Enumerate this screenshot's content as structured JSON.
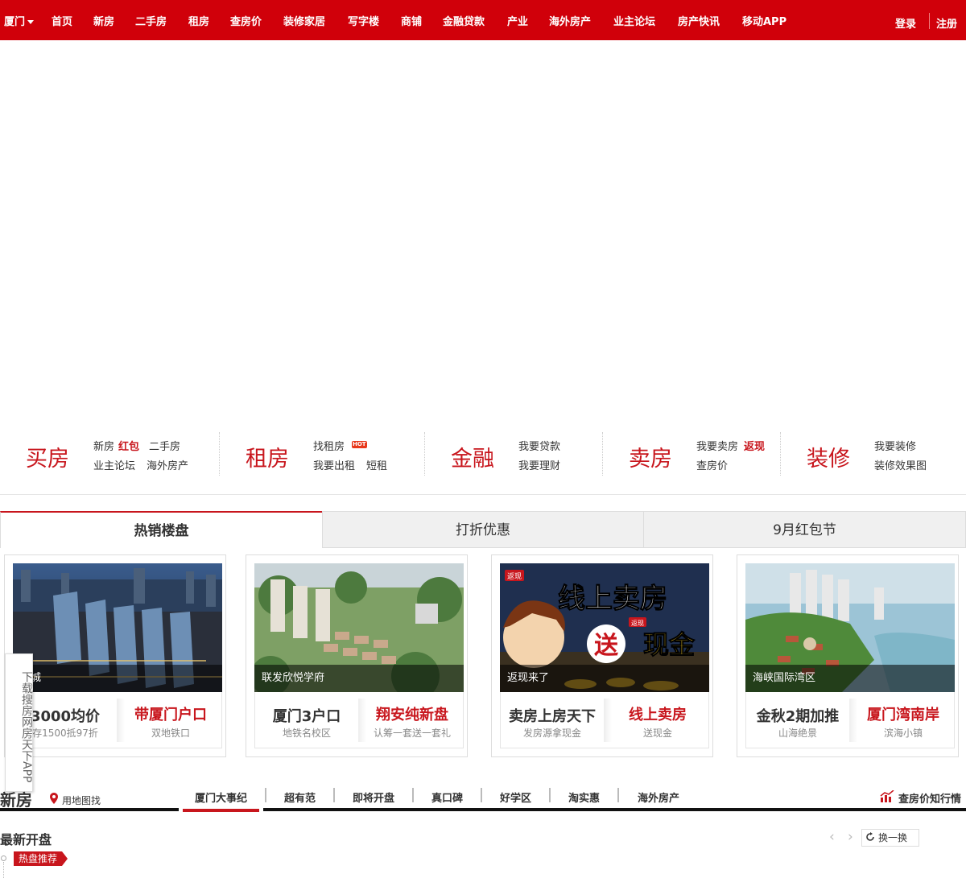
{
  "nav": {
    "city": "厦门",
    "items": [
      "首页",
      "新房",
      "二手房",
      "租房",
      "查房价",
      "装修家居",
      "写字楼",
      "商铺",
      "金融贷款",
      "产业",
      "海外房产",
      "业主论坛",
      "房产快讯",
      "移动APP"
    ],
    "login": "登录",
    "register": "注册"
  },
  "categories": [
    {
      "title": "买房",
      "links": [
        "新房",
        "红包",
        "二手房",
        "业主论坛",
        "海外房产"
      ]
    },
    {
      "title": "租房",
      "links": [
        "找租房",
        "HOT",
        "我要出租",
        "短租"
      ]
    },
    {
      "title": "金融",
      "links": [
        "我要贷款",
        "我要理财"
      ]
    },
    {
      "title": "卖房",
      "links": [
        "我要卖房",
        "返现",
        "查房价"
      ]
    },
    {
      "title": "装修",
      "links": [
        "我要装修",
        "装修效果图"
      ]
    }
  ],
  "tabs": [
    "热销楼盘",
    "打折优惠",
    "9月红包节"
  ],
  "cards": [
    {
      "caption": "澳城",
      "t1": "3000均价",
      "s1": "存1500抵97折",
      "t2": "带厦门户口",
      "s2": "双地铁口"
    },
    {
      "caption": "联发欣悦学府",
      "t1": "厦门3户口",
      "s1": "地铁名校区",
      "t2": "翔安纯新盘",
      "s2": "认筹一套送一套礼"
    },
    {
      "caption": "返现来了",
      "t1": "卖房上房天下",
      "s1": "发房源拿现金",
      "t2": "线上卖房",
      "s2": "送现金",
      "banner": {
        "line1": "线上卖房",
        "line2a": "送",
        "line2b": "现金",
        "tag1": "返现",
        "tag2": "返现"
      }
    },
    {
      "caption": "海峡国际湾区",
      "t1": "金秋2期加推",
      "s1": "山海绝景",
      "t2": "厦门湾南岸",
      "s2": "滨海小镇"
    }
  ],
  "side_app": "下载搜房网房天下APP",
  "newhouse": {
    "title": "新房",
    "map_link": "用地图找",
    "tabs": [
      "厦门大事纪",
      "超有范",
      "即将开盘",
      "真口碑",
      "好学区",
      "淘实惠",
      "海外房产"
    ],
    "trend": "查房价知行情",
    "latest": "最新开盘",
    "swap": "换一换",
    "hot_tag": "热盘推荐",
    "prev": "‹",
    "next": "›"
  }
}
